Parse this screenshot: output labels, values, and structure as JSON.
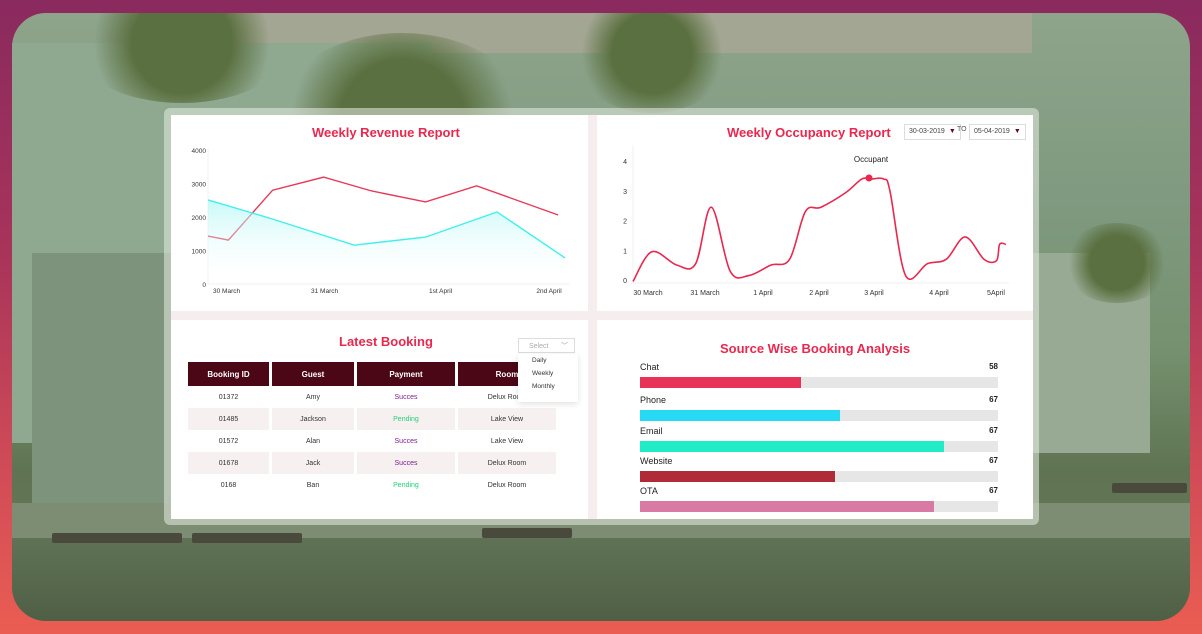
{
  "revenue": {
    "title": "Weekly Revenue Report",
    "chart_data": {
      "type": "line",
      "title": "Weekly Revenue Report",
      "xlabel": "",
      "ylabel": "",
      "ylim": [
        0,
        4000
      ],
      "yticks": [
        "4000",
        "3000",
        "2000",
        "1000",
        "0"
      ],
      "xtick_labels": [
        "30 March",
        "31 March",
        "1st April",
        "2nd April"
      ],
      "xlim": [
        0,
        3
      ],
      "xtick_positions": [
        0,
        1,
        2,
        3
      ],
      "series": [
        {
          "name": "series-red",
          "color": "#e8385a",
          "area": false,
          "x": [
            0,
            0.06,
            0.19,
            0.34,
            0.48,
            0.64,
            0.79,
            1.03
          ],
          "y": [
            1430,
            1310,
            2800,
            3190,
            2780,
            2450,
            2930,
            2060
          ]
        },
        {
          "name": "series-cyan",
          "color": "#3ff0ec",
          "area": true,
          "x": [
            0,
            0.18,
            0.43,
            0.64,
            0.85,
            1.05
          ],
          "y": [
            2510,
            1970,
            1160,
            1400,
            2150,
            780
          ]
        }
      ],
      "grid": false
    }
  },
  "occupancy": {
    "title": "Weekly Occupancy Report",
    "date_from": "30-03-2019",
    "date_to": "05-04-2019",
    "to_label": "TO",
    "chart_data": {
      "type": "line",
      "title": "Weekly Occupancy Report",
      "ylim": [
        0,
        4.5
      ],
      "yticks": [
        "4",
        "3",
        "2",
        "1",
        "0"
      ],
      "xtick_labels": [
        "30 March",
        "31 March",
        "1 April",
        "2 April",
        "3 April",
        "4 April",
        "5April"
      ],
      "annotation": "Occupant",
      "highlight_index": 14,
      "series": [
        {
          "name": "Occupant",
          "color": "#e8284f",
          "x": [
            0,
            0.3,
            0.7,
            1.0,
            1.25,
            1.55,
            1.85,
            2.2,
            2.5,
            2.75,
            3.0,
            3.4,
            3.65,
            3.8,
            4.0,
            4.1,
            4.35,
            4.7,
            5.0,
            5.3,
            5.6,
            5.8,
            5.85,
            5.95
          ],
          "y": [
            -0.05,
            0.95,
            0.5,
            0.55,
            2.45,
            0.3,
            0.15,
            0.5,
            0.7,
            2.3,
            2.45,
            2.95,
            3.4,
            3.4,
            3.4,
            3.0,
            0.15,
            0.55,
            0.7,
            1.45,
            0.7,
            0.65,
            1.2,
            1.2
          ]
        }
      ]
    }
  },
  "booking": {
    "title": "Latest Booking",
    "filter_placeholder": "Select",
    "filter_options": [
      "Daily",
      "Weekly",
      "Monthly"
    ],
    "columns": [
      "Booking ID",
      "Guest",
      "Payment",
      "Room"
    ],
    "rows": [
      {
        "id": "01372",
        "guest": "Amy",
        "payment": "Succes",
        "status": "success",
        "room": "Delux Room"
      },
      {
        "id": "01485",
        "guest": "Jackson",
        "payment": "Pending",
        "status": "pending",
        "room": "Lake View"
      },
      {
        "id": "01572",
        "guest": "Alan",
        "payment": "Succes",
        "status": "success",
        "room": "Lake View"
      },
      {
        "id": "01678",
        "guest": "Jack",
        "payment": "Succes",
        "status": "success",
        "room": "Delux Room"
      },
      {
        "id": "0168",
        "guest": "Ban",
        "payment": "Pending",
        "status": "pending",
        "room": "Delux Room"
      }
    ]
  },
  "source": {
    "title": "Source Wise Booking Analysis",
    "chart_data": {
      "type": "bar",
      "orientation": "horizontal",
      "title": "Source Wise Booking Analysis",
      "categories": [
        "Chat",
        "Phone",
        "Email",
        "Website",
        "OTA"
      ],
      "value_labels": [
        "58",
        "67",
        "67",
        "67",
        "67"
      ],
      "fill_fractions": [
        0.45,
        0.56,
        0.85,
        0.545,
        0.82
      ],
      "colors": [
        "#e83257",
        "#26d9f4",
        "#22ecc8",
        "#b02a38",
        "#d97aa5"
      ]
    }
  }
}
